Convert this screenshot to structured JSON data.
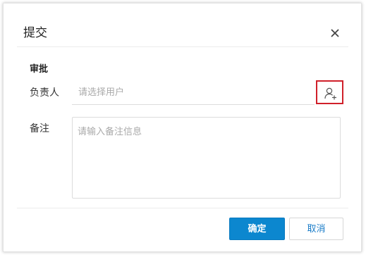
{
  "dialog": {
    "title": "提交",
    "close_icon": "close-icon"
  },
  "approval": {
    "section_title": "审批",
    "assignee_label": "负责人",
    "assignee_placeholder": "请选择用户",
    "assignee_value": "",
    "user_picker_icon": "add-user-icon",
    "remark_label": "备注",
    "remark_placeholder": "请输入备注信息",
    "remark_value": ""
  },
  "footer": {
    "confirm_label": "确定",
    "cancel_label": "取消"
  },
  "colors": {
    "primary": "#0c87cf",
    "link": "#1a7cc8",
    "highlight_border": "#d0202a"
  }
}
